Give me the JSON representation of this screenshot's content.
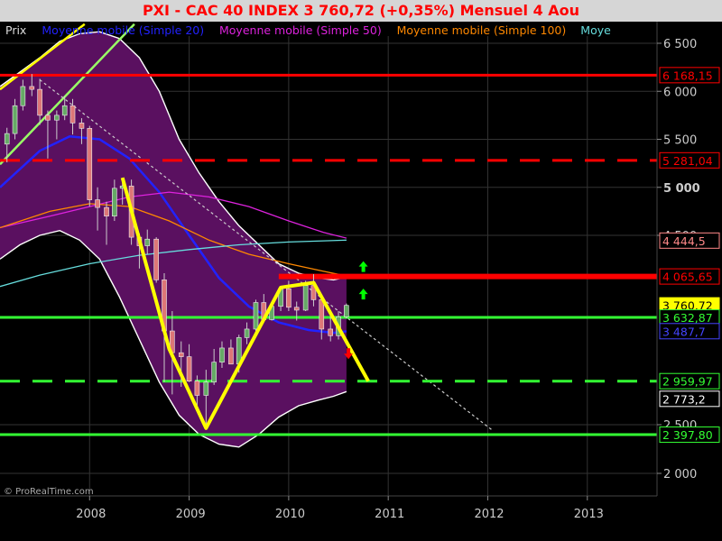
{
  "header": {
    "title": "PXI - CAC 40 INDEX    3 760,72 (+0,35%)    Mensuel  4 Aou"
  },
  "legend": [
    {
      "label": "Prix",
      "color": "#dddddd"
    },
    {
      "label": "Moyenne mobile (Simple 20)",
      "color": "#2222ff"
    },
    {
      "label": "Moyenne mobile (Simple 50)",
      "color": "#dd22dd"
    },
    {
      "label": "Moyenne mobile (Simple 100)",
      "color": "#ff8800"
    },
    {
      "label": "Moye",
      "color": "#66dddd"
    }
  ],
  "watermark": "© ProRealTime.com",
  "colors": {
    "background": "#000000",
    "bollinger_fill": "#5a1060",
    "bollinger_band": "#ffffff",
    "up_candle": "#2e8b2e",
    "down_candle": "#c84040",
    "resistance": "#ff0000",
    "support": "#33ff33",
    "zigzag": "#ffff00",
    "channel_upper": "#ffff00",
    "channel_lower": "#99ff66",
    "trendline": "#cccccc",
    "price_label_bg": "#ffff00"
  },
  "chart_data": {
    "type": "candlestick",
    "title": "PXI - CAC 40 INDEX",
    "last_price": "3 760,72",
    "change": "+0,35%",
    "period": "Mensuel",
    "date_label": "4 Aou",
    "x_tick_labels": [
      "2008",
      "2009",
      "2010",
      "2011",
      "2012",
      "2013"
    ],
    "x_ticks": [
      2008.0,
      2009.0,
      2010.0,
      2011.0,
      2012.0,
      2013.0
    ],
    "xlim": [
      2007.1,
      2013.7
    ],
    "y_axis": "right",
    "y_tick_labels": [
      "6 500",
      "6 000",
      "5 500",
      "5 000",
      "4 500",
      "2 500",
      "2 000"
    ],
    "y_ticks": [
      6500,
      6000,
      5500,
      5000,
      4500,
      2500,
      2000
    ],
    "ylim": [
      1950,
      6700
    ],
    "grid": true,
    "legend_position": "top-left",
    "candles": [
      {
        "t": 2007.17,
        "o": 5450,
        "h": 5620,
        "l": 5260,
        "c": 5560
      },
      {
        "t": 2007.25,
        "o": 5560,
        "h": 5920,
        "l": 5500,
        "c": 5850
      },
      {
        "t": 2007.33,
        "o": 5850,
        "h": 6120,
        "l": 5800,
        "c": 6050
      },
      {
        "t": 2007.42,
        "o": 6050,
        "h": 6180,
        "l": 5950,
        "c": 6020
      },
      {
        "t": 2007.5,
        "o": 6020,
        "h": 6130,
        "l": 5650,
        "c": 5750
      },
      {
        "t": 2007.58,
        "o": 5750,
        "h": 5800,
        "l": 5300,
        "c": 5700
      },
      {
        "t": 2007.67,
        "o": 5700,
        "h": 5800,
        "l": 5500,
        "c": 5750
      },
      {
        "t": 2007.75,
        "o": 5750,
        "h": 5950,
        "l": 5700,
        "c": 5850
      },
      {
        "t": 2007.83,
        "o": 5850,
        "h": 5920,
        "l": 5550,
        "c": 5670
      },
      {
        "t": 2007.92,
        "o": 5670,
        "h": 5720,
        "l": 5450,
        "c": 5614
      },
      {
        "t": 2008.0,
        "o": 5614,
        "h": 5640,
        "l": 4800,
        "c": 4870
      },
      {
        "t": 2008.08,
        "o": 4870,
        "h": 5000,
        "l": 4550,
        "c": 4790
      },
      {
        "t": 2008.17,
        "o": 4790,
        "h": 4850,
        "l": 4400,
        "c": 4700
      },
      {
        "t": 2008.25,
        "o": 4700,
        "h": 5080,
        "l": 4650,
        "c": 4990
      },
      {
        "t": 2008.33,
        "o": 4990,
        "h": 5100,
        "l": 4820,
        "c": 5014
      },
      {
        "t": 2008.42,
        "o": 5014,
        "h": 5080,
        "l": 4400,
        "c": 4480
      },
      {
        "t": 2008.5,
        "o": 4480,
        "h": 4520,
        "l": 4150,
        "c": 4390
      },
      {
        "t": 2008.58,
        "o": 4390,
        "h": 4560,
        "l": 4300,
        "c": 4460
      },
      {
        "t": 2008.67,
        "o": 4460,
        "h": 4480,
        "l": 4000,
        "c": 4030
      },
      {
        "t": 2008.75,
        "o": 4030,
        "h": 4100,
        "l": 2950,
        "c": 3490
      },
      {
        "t": 2008.83,
        "o": 3490,
        "h": 3700,
        "l": 2820,
        "c": 3260
      },
      {
        "t": 2008.92,
        "o": 3260,
        "h": 3380,
        "l": 2900,
        "c": 3218
      },
      {
        "t": 2009.0,
        "o": 3218,
        "h": 3350,
        "l": 2950,
        "c": 2960
      },
      {
        "t": 2009.08,
        "o": 2960,
        "h": 3020,
        "l": 2700,
        "c": 2810
      },
      {
        "t": 2009.17,
        "o": 2810,
        "h": 3080,
        "l": 2465,
        "c": 2950
      },
      {
        "t": 2009.25,
        "o": 2950,
        "h": 3300,
        "l": 2920,
        "c": 3160
      },
      {
        "t": 2009.33,
        "o": 3160,
        "h": 3380,
        "l": 3100,
        "c": 3310
      },
      {
        "t": 2009.42,
        "o": 3310,
        "h": 3400,
        "l": 3150,
        "c": 3140
      },
      {
        "t": 2009.5,
        "o": 3140,
        "h": 3450,
        "l": 3050,
        "c": 3420
      },
      {
        "t": 2009.58,
        "o": 3420,
        "h": 3580,
        "l": 3350,
        "c": 3510
      },
      {
        "t": 2009.67,
        "o": 3510,
        "h": 3820,
        "l": 3480,
        "c": 3790
      },
      {
        "t": 2009.75,
        "o": 3790,
        "h": 3880,
        "l": 3600,
        "c": 3610
      },
      {
        "t": 2009.83,
        "o": 3610,
        "h": 3800,
        "l": 3600,
        "c": 3750
      },
      {
        "t": 2009.92,
        "o": 3750,
        "h": 3950,
        "l": 3700,
        "c": 3936
      },
      {
        "t": 2010.0,
        "o": 3936,
        "h": 4020,
        "l": 3700,
        "c": 3740
      },
      {
        "t": 2010.08,
        "o": 3740,
        "h": 3800,
        "l": 3600,
        "c": 3710
      },
      {
        "t": 2010.17,
        "o": 3710,
        "h": 4020,
        "l": 3700,
        "c": 3970
      },
      {
        "t": 2010.25,
        "o": 3970,
        "h": 4090,
        "l": 3750,
        "c": 3820
      },
      {
        "t": 2010.33,
        "o": 3820,
        "h": 3850,
        "l": 3400,
        "c": 3510
      },
      {
        "t": 2010.42,
        "o": 3510,
        "h": 3700,
        "l": 3380,
        "c": 3440
      },
      {
        "t": 2010.5,
        "o": 3440,
        "h": 3700,
        "l": 3400,
        "c": 3640
      },
      {
        "t": 2010.58,
        "o": 3640,
        "h": 3780,
        "l": 3620,
        "c": 3760
      }
    ],
    "moving_averages": [
      {
        "name": "Moyenne mobile (Simple 20)",
        "period": 20,
        "color": "#2222ff",
        "points": [
          [
            2007.1,
            5000
          ],
          [
            2007.5,
            5380
          ],
          [
            2007.8,
            5530
          ],
          [
            2008.1,
            5500
          ],
          [
            2008.4,
            5300
          ],
          [
            2008.7,
            4950
          ],
          [
            2009.0,
            4500
          ],
          [
            2009.3,
            4050
          ],
          [
            2009.6,
            3750
          ],
          [
            2009.9,
            3580
          ],
          [
            2010.2,
            3500
          ],
          [
            2010.45,
            3470
          ],
          [
            2010.58,
            3487
          ]
        ]
      },
      {
        "name": "Moyenne mobile (Simple 50)",
        "period": 50,
        "color": "#dd22dd",
        "points": [
          [
            2007.1,
            4580
          ],
          [
            2007.6,
            4700
          ],
          [
            2008.0,
            4800
          ],
          [
            2008.4,
            4900
          ],
          [
            2008.8,
            4950
          ],
          [
            2009.2,
            4900
          ],
          [
            2009.6,
            4800
          ],
          [
            2010.0,
            4650
          ],
          [
            2010.35,
            4530
          ],
          [
            2010.58,
            4470
          ]
        ]
      },
      {
        "name": "Moyenne mobile (Simple 100)",
        "period": 100,
        "color": "#ff8800",
        "points": [
          [
            2007.1,
            4580
          ],
          [
            2007.6,
            4750
          ],
          [
            2008.0,
            4830
          ],
          [
            2008.4,
            4800
          ],
          [
            2008.8,
            4650
          ],
          [
            2009.2,
            4450
          ],
          [
            2009.6,
            4300
          ],
          [
            2010.0,
            4200
          ],
          [
            2010.35,
            4120
          ],
          [
            2010.58,
            4070
          ]
        ]
      },
      {
        "name": "Moye",
        "period": null,
        "color": "#66dddd",
        "points": [
          [
            2007.1,
            3960
          ],
          [
            2007.5,
            4080
          ],
          [
            2008.0,
            4200
          ],
          [
            2008.5,
            4290
          ],
          [
            2009.0,
            4350
          ],
          [
            2009.5,
            4400
          ],
          [
            2010.0,
            4430
          ],
          [
            2010.58,
            4450
          ]
        ]
      }
    ],
    "bollinger_bands": {
      "upper": [
        [
          2007.1,
          6050
        ],
        [
          2007.3,
          6200
        ],
        [
          2007.5,
          6350
        ],
        [
          2007.7,
          6520
        ],
        [
          2007.9,
          6600
        ],
        [
          2008.1,
          6620
        ],
        [
          2008.3,
          6550
        ],
        [
          2008.5,
          6350
        ],
        [
          2008.7,
          6000
        ],
        [
          2008.9,
          5500
        ],
        [
          2009.1,
          5150
        ],
        [
          2009.3,
          4850
        ],
        [
          2009.5,
          4600
        ],
        [
          2009.7,
          4400
        ],
        [
          2009.9,
          4200
        ],
        [
          2010.1,
          4100
        ],
        [
          2010.3,
          4050
        ],
        [
          2010.45,
          4030
        ],
        [
          2010.58,
          4060
        ]
      ],
      "lower": [
        [
          2007.1,
          4250
        ],
        [
          2007.3,
          4400
        ],
        [
          2007.5,
          4500
        ],
        [
          2007.7,
          4550
        ],
        [
          2007.9,
          4450
        ],
        [
          2008.1,
          4250
        ],
        [
          2008.3,
          3850
        ],
        [
          2008.5,
          3400
        ],
        [
          2008.7,
          2950
        ],
        [
          2008.9,
          2600
        ],
        [
          2009.1,
          2400
        ],
        [
          2009.3,
          2300
        ],
        [
          2009.5,
          2270
        ],
        [
          2009.7,
          2400
        ],
        [
          2009.9,
          2580
        ],
        [
          2010.1,
          2700
        ],
        [
          2010.3,
          2760
        ],
        [
          2010.45,
          2800
        ],
        [
          2010.58,
          2850
        ]
      ]
    },
    "levels": [
      {
        "label": "6 168,15",
        "value": 6168.15,
        "color": "#ff0000",
        "style": "solid"
      },
      {
        "label": "5 281,04",
        "value": 5281.04,
        "color": "#ff0000",
        "style": "dashed"
      },
      {
        "label": "4 444,5",
        "value": 4444.5,
        "color": "#ff8888",
        "style": "label-only"
      },
      {
        "label": "4 065,65",
        "value": 4065.65,
        "color": "#ff0000",
        "style": "solid-short"
      },
      {
        "label": "3 760,72",
        "value": 3760.72,
        "color": "#ffff00",
        "style": "price"
      },
      {
        "label": "3 632,87",
        "value": 3632.87,
        "color": "#33ff33",
        "style": "solid"
      },
      {
        "label": "3 487,7",
        "value": 3487.7,
        "color": "#4444ff",
        "style": "label-only"
      },
      {
        "label": "2 959,97",
        "value": 2959.97,
        "color": "#33ff33",
        "style": "dashed"
      },
      {
        "label": "2 773,2",
        "value": 2773.2,
        "color": "#ffffff",
        "style": "label-only"
      },
      {
        "label": "2 397,80",
        "value": 2397.8,
        "color": "#33ff33",
        "style": "solid"
      }
    ],
    "zigzag": [
      [
        2008.33,
        5100
      ],
      [
        2008.8,
        3300
      ],
      [
        2009.17,
        2465
      ],
      [
        2009.92,
        3950
      ],
      [
        2010.25,
        4000
      ],
      [
        2010.8,
        2960
      ]
    ],
    "channel_upper": [
      [
        2007.1,
        6020
      ],
      [
        2007.95,
        6700
      ]
    ],
    "channel_lower": [
      [
        2007.1,
        5240
      ],
      [
        2008.45,
        6700
      ]
    ],
    "trendline": [
      [
        2007.5,
        6120
      ],
      [
        2012.05,
        2440
      ]
    ],
    "arrows": [
      {
        "t": 2010.75,
        "value": 4170,
        "dir": "up",
        "color": "#00ff00"
      },
      {
        "t": 2010.75,
        "value": 3880,
        "dir": "up",
        "color": "#00ff00"
      },
      {
        "t": 2010.6,
        "value": 3250,
        "dir": "down",
        "color": "#ff0000"
      }
    ]
  }
}
